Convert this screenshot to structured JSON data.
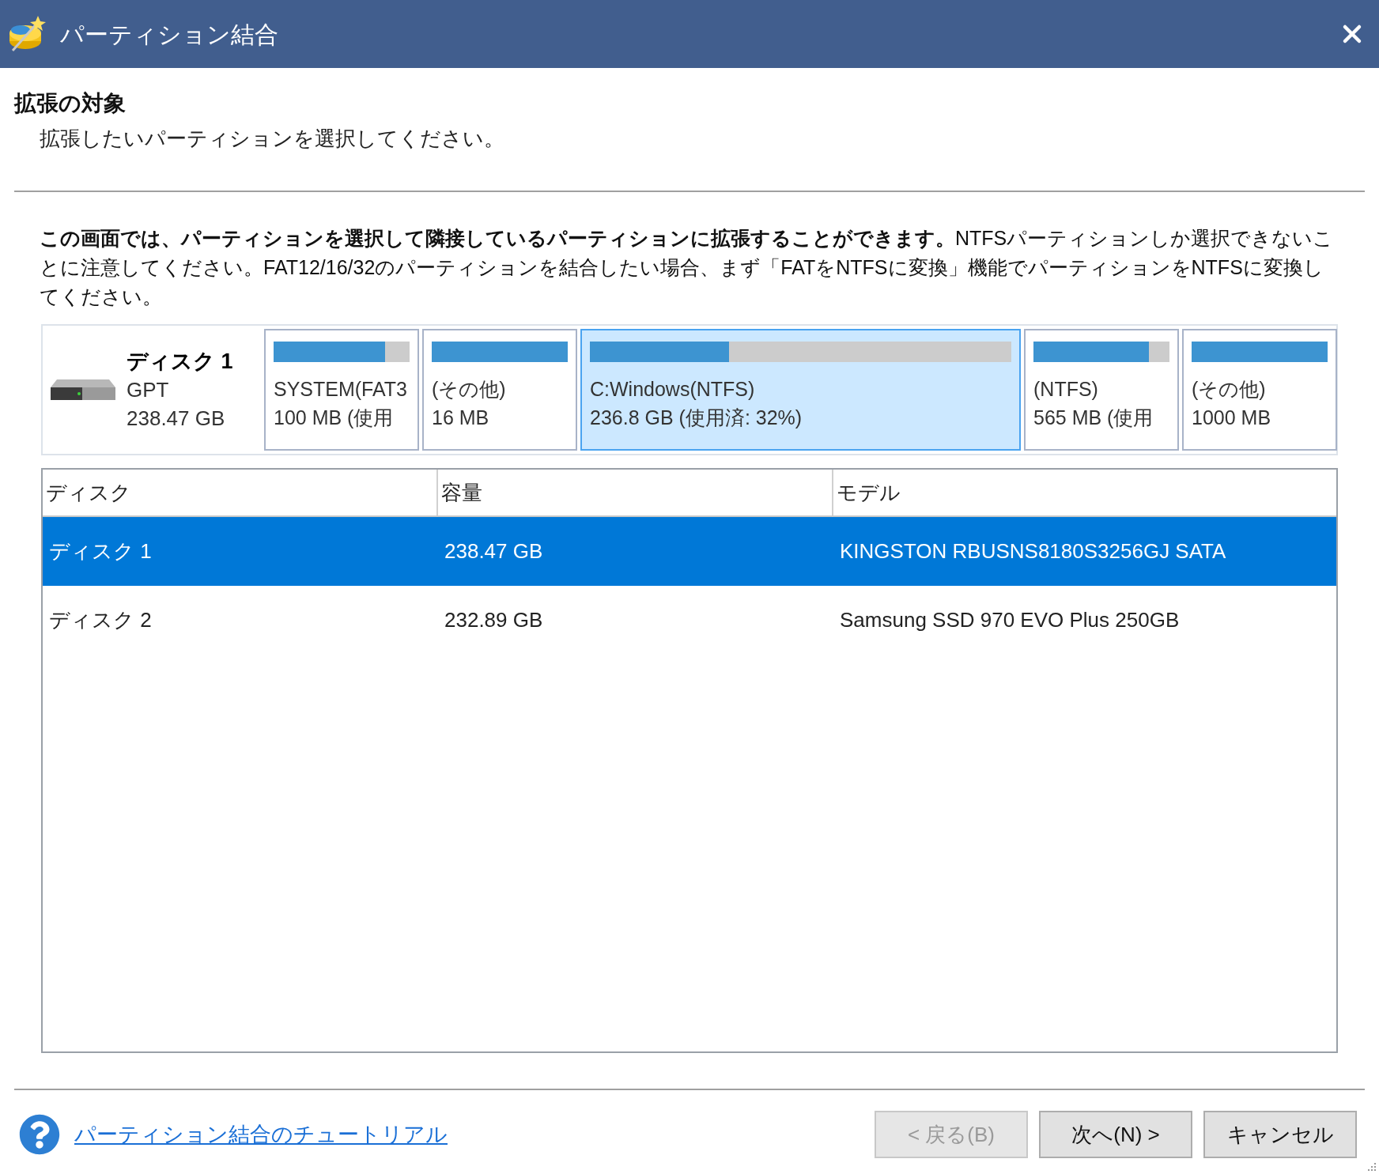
{
  "window": {
    "title": "パーティション結合"
  },
  "header": {
    "title": "拡張の対象",
    "subtitle": "拡張したいパーティションを選択してください。"
  },
  "description": "**この画面では、パーティションを選択して隣接しているパーティションに拡張することができます。**NTFSパーティションしか選択できないことに注意してください。FAT12/16/32のパーティションを結合したい場合、まず「FATをNTFSに変換」機能でパーティションをNTFSに変換してください。",
  "disk_map": {
    "disk": {
      "name": "ディスク 1",
      "type": "GPT",
      "size": "238.47 GB"
    },
    "partitions": [
      {
        "label": "SYSTEM(FAT3",
        "size": "100 MB (使用",
        "level": 0.82,
        "selected": false
      },
      {
        "label": "(その他)",
        "size": "16 MB",
        "level": 1,
        "selected": false
      },
      {
        "label": "C:Windows(NTFS)",
        "size": "236.8 GB (使用済: 32%)",
        "level": 0.33,
        "selected": true
      },
      {
        "label": "(NTFS)",
        "size": "565 MB (使用",
        "level": 0.85,
        "selected": false
      },
      {
        "label": "(その他)",
        "size": "1000 MB",
        "level": 1,
        "selected": false
      }
    ]
  },
  "table": {
    "columns": [
      "ディスク",
      "容量",
      "モデル"
    ],
    "rows": [
      {
        "cells": [
          "ディスク 1",
          "238.47 GB",
          "KINGSTON RBUSNS8180S3256GJ SATA"
        ],
        "selected": true
      },
      {
        "cells": [
          "ディスク 2",
          "232.89 GB",
          "Samsung SSD 970 EVO Plus 250GB"
        ],
        "selected": false
      }
    ]
  },
  "footer": {
    "tutorial_link": "パーティション結合のチュートリアル",
    "buttons": [
      {
        "label": "< 戻る(B)",
        "disabled": true
      },
      {
        "label": "次へ(N) >",
        "disabled": false
      },
      {
        "label": "キャンセル",
        "disabled": false
      }
    ]
  }
}
